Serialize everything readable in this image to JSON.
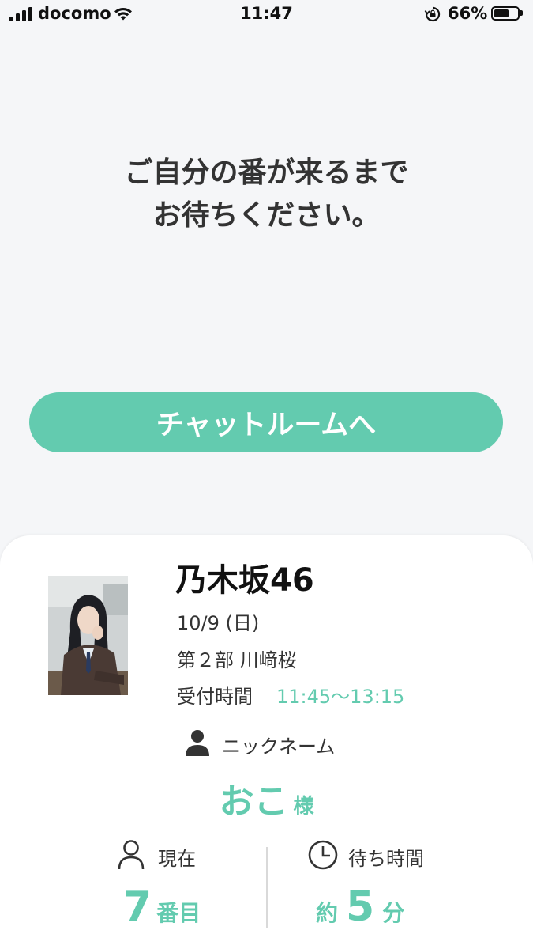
{
  "status_bar": {
    "carrier": "docomo",
    "time": "11:47",
    "battery_percent": "66%",
    "battery_level": 0.66
  },
  "message": {
    "line1": "ご自分の番が来るまで",
    "line2": "お待ちください。"
  },
  "chat_button": {
    "label": "チャットルームへ"
  },
  "event": {
    "group": "乃木坂46",
    "date": "10/9 (日)",
    "session": "第２部 川﨑桜",
    "reception_label": "受付時間",
    "reception_time": "11:45〜13:15"
  },
  "nickname": {
    "label": "ニックネーム",
    "value": "おこ",
    "honorific": "様"
  },
  "queue": {
    "current_label": "現在",
    "current_number": "7",
    "current_unit": "番目",
    "wait_label": "待ち時間",
    "wait_prefix": "約",
    "wait_minutes": "5",
    "wait_unit": "分"
  },
  "colors": {
    "accent": "#63cbaf",
    "background": "#f5f6f8",
    "card": "#ffffff",
    "text": "#333333"
  },
  "icons": {
    "signal": "cellular-signal-icon",
    "wifi": "wifi-icon",
    "rotation_lock": "rotation-lock-icon",
    "battery": "battery-icon",
    "person_filled": "person-filled-icon",
    "person_outline": "person-outline-icon",
    "clock": "clock-icon"
  }
}
